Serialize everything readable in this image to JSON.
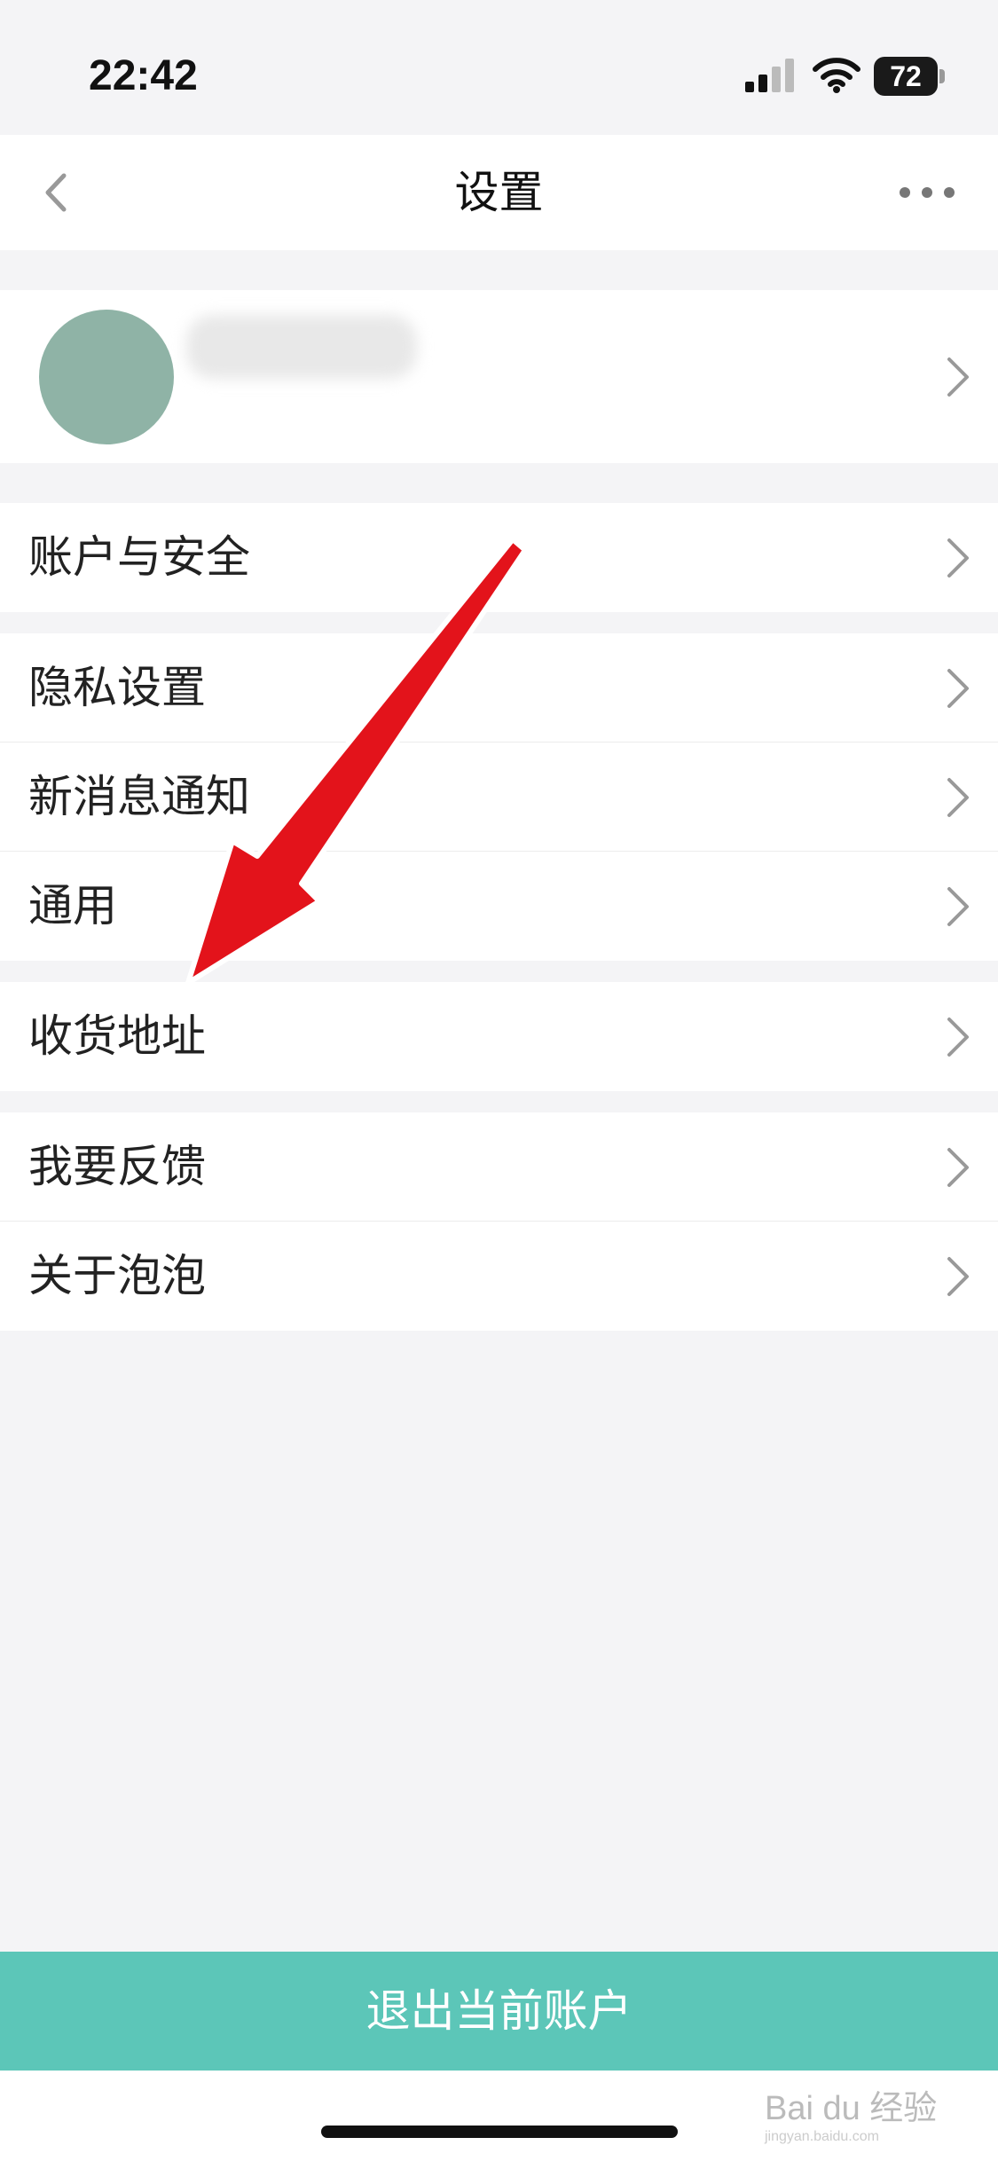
{
  "status_bar": {
    "time": "22:42",
    "battery": "72"
  },
  "nav": {
    "title": "设置",
    "back_icon": "chevron-left-icon",
    "more_icon": "ellipsis-icon"
  },
  "menu": {
    "account_security": "账户与安全",
    "privacy": "隐私设置",
    "notifications": "新消息通知",
    "general": "通用",
    "address": "收货地址",
    "feedback": "我要反馈",
    "about": "关于泡泡"
  },
  "logout": {
    "label": "退出当前账户"
  },
  "watermark": {
    "brand": "Bai du 经验",
    "url": "jingyan.baidu.com"
  },
  "colors": {
    "accent": "#5cc6b8",
    "arrow": "#e3131b",
    "avatar": "#8fb3a6"
  }
}
